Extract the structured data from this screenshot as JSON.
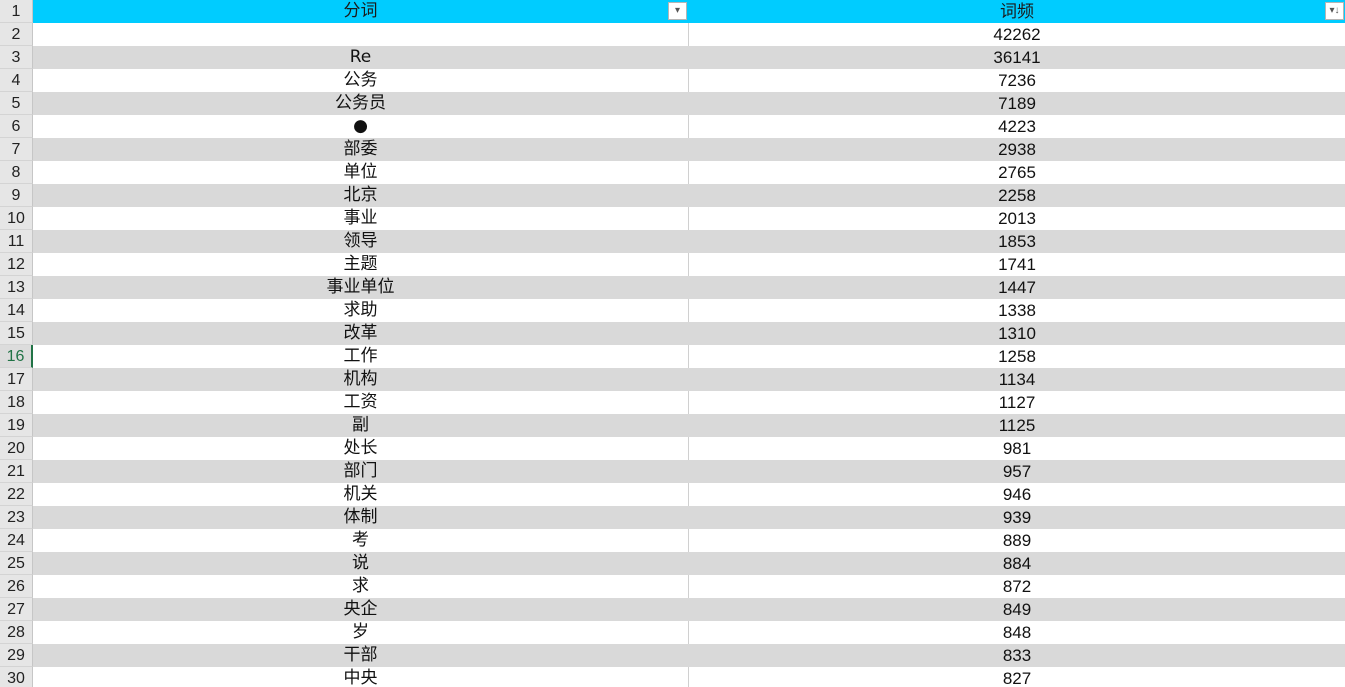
{
  "header": {
    "row_number": "1",
    "col_a": "分词",
    "col_b": "词频",
    "filter_a_glyph": "▾",
    "filter_b_glyph": "▾↓"
  },
  "active_row": "16",
  "rows": [
    {
      "n": "2",
      "word": "",
      "freq": "42262"
    },
    {
      "n": "3",
      "word": "Re",
      "freq": "36141"
    },
    {
      "n": "4",
      "word": "公务",
      "freq": "7236"
    },
    {
      "n": "5",
      "word": "公务员",
      "freq": "7189"
    },
    {
      "n": "6",
      "word": "●",
      "freq": "4223"
    },
    {
      "n": "7",
      "word": "部委",
      "freq": "2938"
    },
    {
      "n": "8",
      "word": "单位",
      "freq": "2765"
    },
    {
      "n": "9",
      "word": "北京",
      "freq": "2258"
    },
    {
      "n": "10",
      "word": "事业",
      "freq": "2013"
    },
    {
      "n": "11",
      "word": "领导",
      "freq": "1853"
    },
    {
      "n": "12",
      "word": "主题",
      "freq": "1741"
    },
    {
      "n": "13",
      "word": "事业单位",
      "freq": "1447"
    },
    {
      "n": "14",
      "word": "求助",
      "freq": "1338"
    },
    {
      "n": "15",
      "word": "改革",
      "freq": "1310"
    },
    {
      "n": "16",
      "word": "工作",
      "freq": "1258"
    },
    {
      "n": "17",
      "word": "机构",
      "freq": "1134"
    },
    {
      "n": "18",
      "word": "工资",
      "freq": "1127"
    },
    {
      "n": "19",
      "word": "副",
      "freq": "1125"
    },
    {
      "n": "20",
      "word": "处长",
      "freq": "981"
    },
    {
      "n": "21",
      "word": "部门",
      "freq": "957"
    },
    {
      "n": "22",
      "word": "机关",
      "freq": "946"
    },
    {
      "n": "23",
      "word": "体制",
      "freq": "939"
    },
    {
      "n": "24",
      "word": "考",
      "freq": "889"
    },
    {
      "n": "25",
      "word": "说",
      "freq": "884"
    },
    {
      "n": "26",
      "word": "求",
      "freq": "872"
    },
    {
      "n": "27",
      "word": "央企",
      "freq": "849"
    },
    {
      "n": "28",
      "word": "岁",
      "freq": "848"
    },
    {
      "n": "29",
      "word": "干部",
      "freq": "833"
    },
    {
      "n": "30",
      "word": "中央",
      "freq": "827"
    }
  ],
  "colors": {
    "header_fill": "#00ccff",
    "band_fill": "#d9d9d9",
    "active_row_accent": "#217346"
  }
}
